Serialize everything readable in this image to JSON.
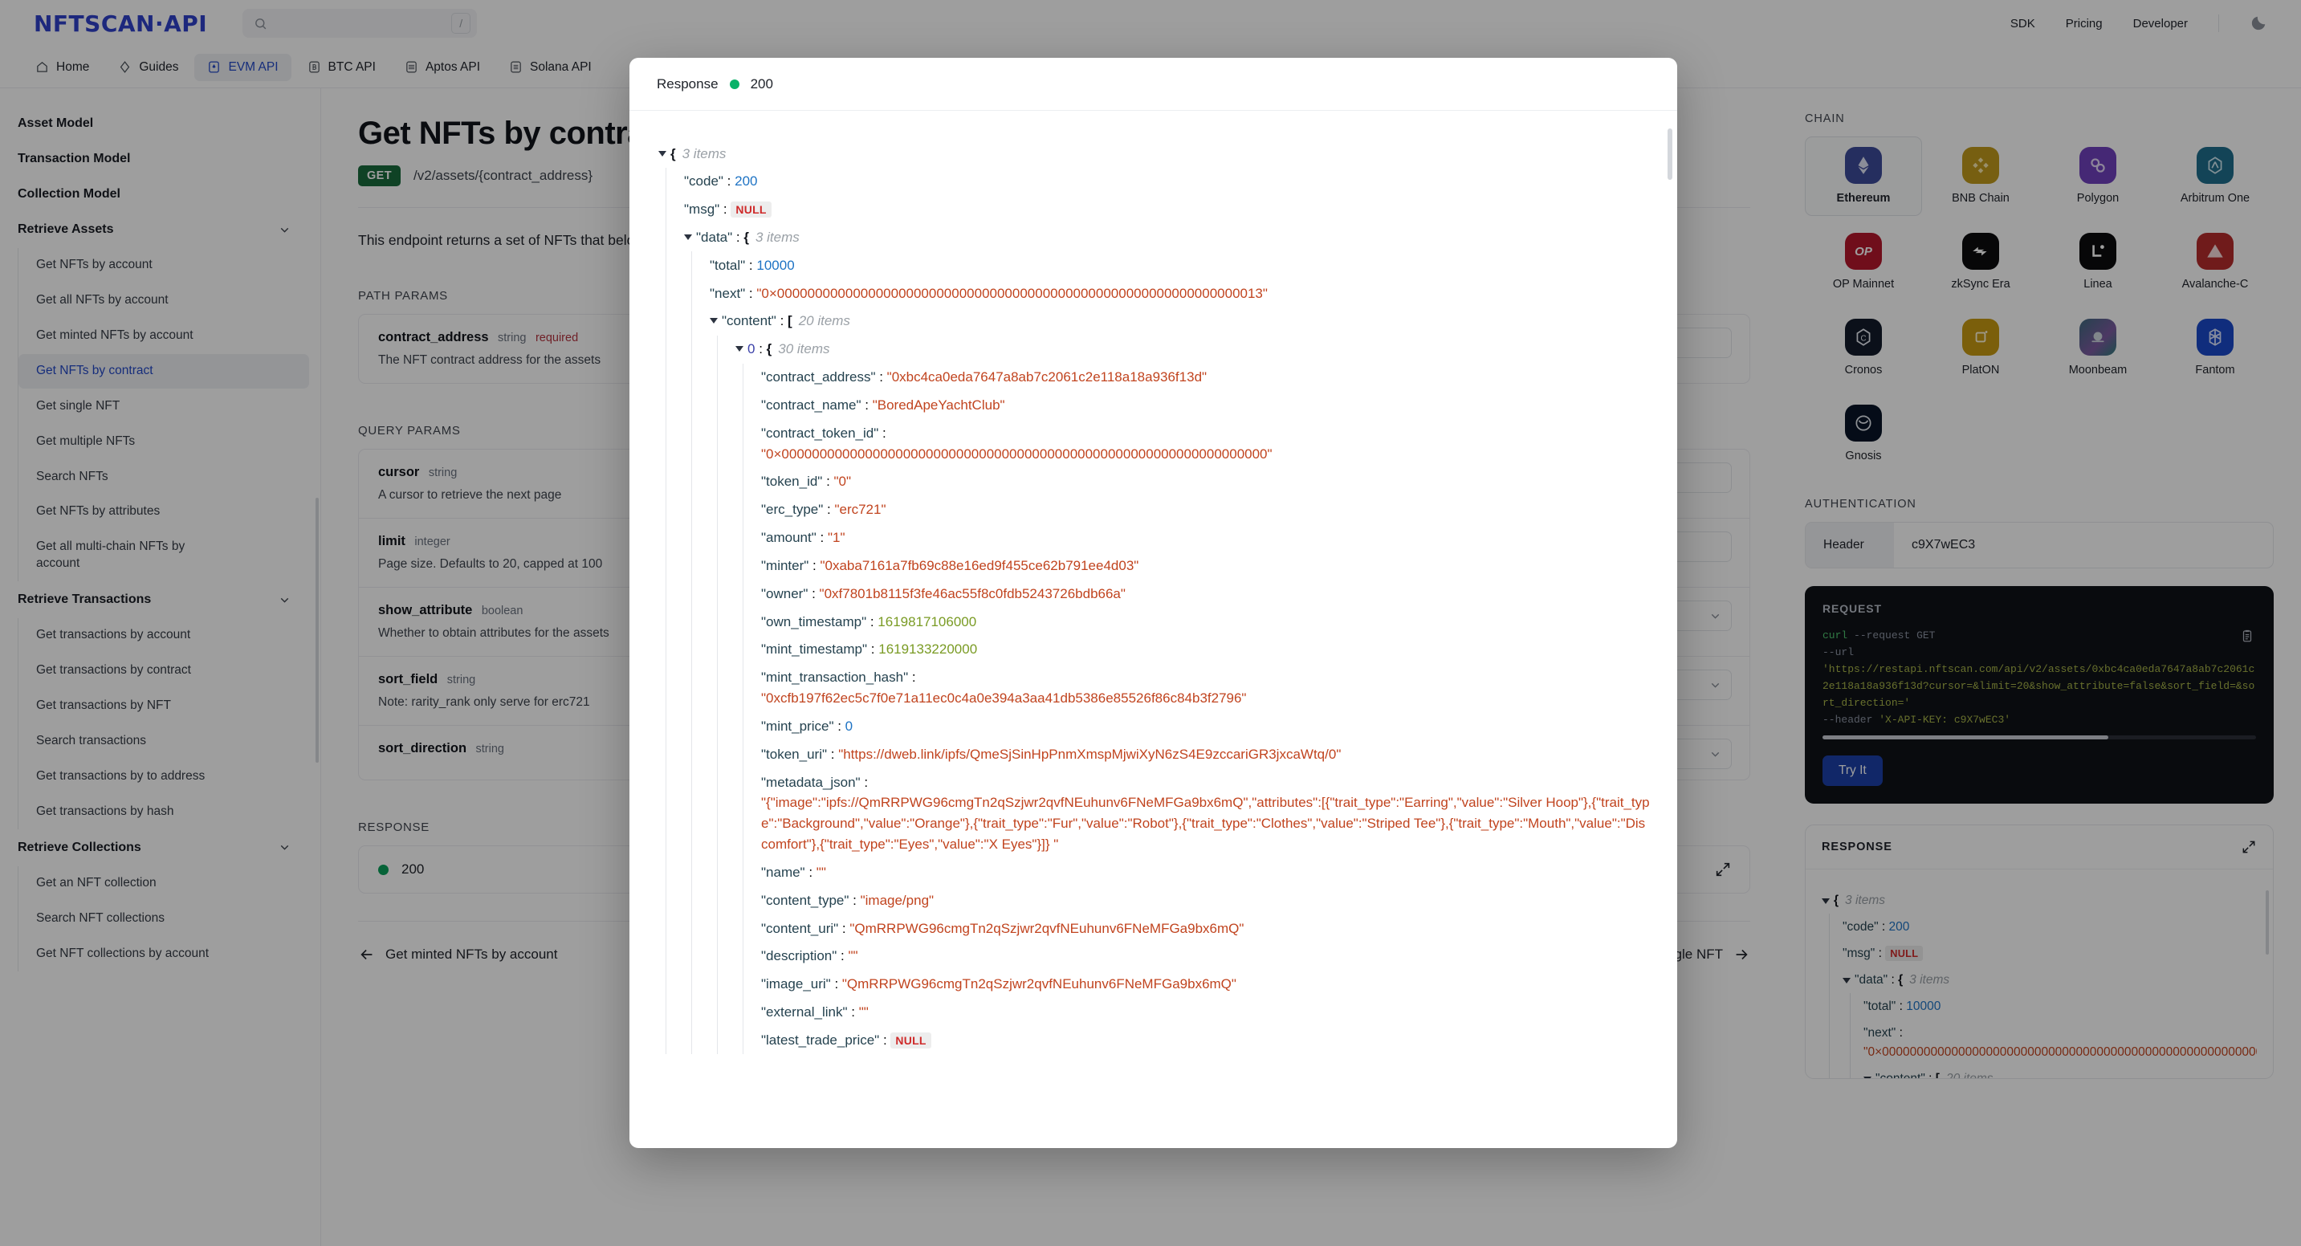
{
  "header": {
    "logo": "NFTSCAN·API",
    "search": {
      "value": "",
      "placeholder": "",
      "shortcut": "/"
    },
    "links": [
      "SDK",
      "Pricing",
      "Developer"
    ],
    "theme_toggle_icon": "moon-icon"
  },
  "nav": {
    "tabs": [
      {
        "label": "Home",
        "icon": "home-icon",
        "active": false
      },
      {
        "label": "Guides",
        "icon": "diamond-icon",
        "active": false
      },
      {
        "label": "EVM API",
        "icon": "ethereum-icon",
        "active": true
      },
      {
        "label": "BTC API",
        "icon": "bitcoin-icon",
        "active": false
      },
      {
        "label": "Aptos API",
        "icon": "aptos-icon",
        "active": false
      },
      {
        "label": "Solana API",
        "icon": "solana-icon",
        "active": false
      }
    ]
  },
  "sidebar": {
    "groups": [
      {
        "label": "Asset Model",
        "collapsible": false,
        "items": []
      },
      {
        "label": "Transaction Model",
        "collapsible": false,
        "items": []
      },
      {
        "label": "Collection Model",
        "collapsible": false,
        "items": []
      },
      {
        "label": "Retrieve Assets",
        "collapsible": true,
        "items": [
          {
            "label": "Get NFTs by account",
            "active": false
          },
          {
            "label": "Get all NFTs by account",
            "active": false
          },
          {
            "label": "Get minted NFTs by account",
            "active": false
          },
          {
            "label": "Get NFTs by contract",
            "active": true
          },
          {
            "label": "Get single NFT",
            "active": false
          },
          {
            "label": "Get multiple NFTs",
            "active": false
          },
          {
            "label": "Search NFTs",
            "active": false
          },
          {
            "label": "Get NFTs by attributes",
            "active": false
          },
          {
            "label": "Get all multi-chain NFTs by account",
            "active": false
          }
        ]
      },
      {
        "label": "Retrieve Transactions",
        "collapsible": true,
        "items": [
          {
            "label": "Get transactions by account",
            "active": false
          },
          {
            "label": "Get transactions by contract",
            "active": false
          },
          {
            "label": "Get transactions by NFT",
            "active": false
          },
          {
            "label": "Search transactions",
            "active": false
          },
          {
            "label": "Get transactions by to address",
            "active": false
          },
          {
            "label": "Get transactions by hash",
            "active": false
          }
        ]
      },
      {
        "label": "Retrieve Collections",
        "collapsible": true,
        "items": [
          {
            "label": "Get an NFT collection",
            "active": false
          },
          {
            "label": "Search NFT collections",
            "active": false
          },
          {
            "label": "Get NFT collections by account",
            "active": false
          }
        ]
      }
    ]
  },
  "doc": {
    "title": "Get NFTs by contract",
    "method": "GET",
    "path": "/v2/assets/{contract_address}",
    "description": "This endpoint returns a set of NFTs that belong to an NFT contract address.",
    "path_params_label": "PATH PARAMS",
    "query_params_label": "QUERY PARAMS",
    "response_label": "RESPONSE",
    "path_params": [
      {
        "name": "contract_address",
        "type": "string",
        "required": "required",
        "desc": "The NFT contract address for the assets"
      }
    ],
    "query_params": [
      {
        "name": "cursor",
        "type": "string",
        "required": "",
        "desc": "A cursor to retrieve the next page",
        "control": "input"
      },
      {
        "name": "limit",
        "type": "integer",
        "required": "",
        "desc": "Page size. Defaults to 20, capped at 100",
        "control": "input"
      },
      {
        "name": "show_attribute",
        "type": "boolean",
        "required": "",
        "desc": "Whether to obtain attributes for the assets",
        "control": "select"
      },
      {
        "name": "sort_field",
        "type": "string",
        "required": "",
        "desc": "Note: rarity_rank only serve for erc721",
        "control": "select"
      },
      {
        "name": "sort_direction",
        "type": "string",
        "required": "",
        "desc": "",
        "control": "select"
      }
    ],
    "response_status": "200",
    "pager": {
      "prev": "Get minted NFTs by account",
      "next": "Get single NFT"
    }
  },
  "rail": {
    "chain_label": "CHAIN",
    "chains": [
      {
        "name": "Ethereum",
        "active": true,
        "bg": "#3c4a99",
        "glyph": "eth"
      },
      {
        "name": "BNB Chain",
        "active": false,
        "bg": "#c09a1b",
        "glyph": "bnb"
      },
      {
        "name": "Polygon",
        "active": false,
        "bg": "#6f41bd",
        "glyph": "polygon"
      },
      {
        "name": "Arbitrum One",
        "active": false,
        "bg": "#1e6e8c",
        "glyph": "arb"
      },
      {
        "name": "OP Mainnet",
        "active": false,
        "bg": "#b4162b",
        "glyph": "op"
      },
      {
        "name": "zkSync Era",
        "active": false,
        "bg": "#0b0b0d",
        "glyph": "zk"
      },
      {
        "name": "Linea",
        "active": false,
        "bg": "#0b0b0d",
        "glyph": "linea"
      },
      {
        "name": "Avalanche-C",
        "active": false,
        "bg": "#b42b2b",
        "glyph": "avax"
      },
      {
        "name": "Cronos",
        "active": false,
        "bg": "#121a2a",
        "glyph": "cronos"
      },
      {
        "name": "PlatON",
        "active": false,
        "bg": "#c79a12",
        "glyph": "platon"
      },
      {
        "name": "Moonbeam",
        "active": false,
        "bg": "#2e7d7a",
        "glyph": "moonbeam"
      },
      {
        "name": "Fantom",
        "active": false,
        "bg": "#1a49c9",
        "glyph": "fantom"
      },
      {
        "name": "Gnosis",
        "active": false,
        "bg": "#081426",
        "glyph": "gnosis"
      }
    ],
    "auth_label": "AUTHENTICATION",
    "auth_key_label": "Header",
    "auth_key_value": "c9X7wEC3",
    "request_label": "REQUEST",
    "request": {
      "cmd": "curl",
      "flag_request": "--request",
      "method": "GET",
      "flag_url": "--url",
      "url": "'https://restapi.nftscan.com/api/v2/assets/0xbc4ca0eda7647a8ab7c2061c2e118a18a936f13d?cursor=&limit=20&show_attribute=false&sort_field=&sort_direction='",
      "flag_header": "--header",
      "header": "'X-API-KEY: c9X7wEC3'"
    },
    "try_it_label": "Try It",
    "response_label": "RESPONSE",
    "expand_icon": "expand-icon",
    "copy_icon": "clipboard-icon"
  },
  "modal": {
    "title": "Response",
    "status_dot_color": "#09b268",
    "status": "200"
  },
  "json_tree": {
    "root_items": "3 items",
    "code_key": "\"code\"",
    "code_value": "200",
    "msg_key": "\"msg\"",
    "msg_value": "NULL",
    "data_key": "\"data\"",
    "data_items": "3 items",
    "total_key": "\"total\"",
    "total_value": "10000",
    "next_key": "\"next\"",
    "next_value": "\"0×0000000000000000000000000000000000000000000000000000000000000013\"",
    "content_key": "\"content\"",
    "content_items": "20 items",
    "index0": "0",
    "index0_items": "30 items",
    "fields": [
      {
        "key": "\"contract_address\"",
        "value": "\"0xbc4ca0eda7647a8ab7c2061c2e118a18a936f13d\"",
        "kind": "str",
        "wrap": false
      },
      {
        "key": "\"contract_name\"",
        "value": "\"BoredApeYachtClub\"",
        "kind": "str",
        "wrap": false
      },
      {
        "key": "\"contract_token_id\"",
        "value": "\"0×0000000000000000000000000000000000000000000000000000000000000000\"",
        "kind": "str",
        "wrap": true
      },
      {
        "key": "\"token_id\"",
        "value": "\"0\"",
        "kind": "str",
        "wrap": false
      },
      {
        "key": "\"erc_type\"",
        "value": "\"erc721\"",
        "kind": "str",
        "wrap": false
      },
      {
        "key": "\"amount\"",
        "value": "\"1\"",
        "kind": "str",
        "wrap": false
      },
      {
        "key": "\"minter\"",
        "value": "\"0xaba7161a7fb69c88e16ed9f455ce62b791ee4d03\"",
        "kind": "str",
        "wrap": false
      },
      {
        "key": "\"owner\"",
        "value": "\"0xf7801b8115f3fe46ac55f8c0fdb5243726bdb66a\"",
        "kind": "str",
        "wrap": false
      },
      {
        "key": "\"own_timestamp\"",
        "value": "1619817106000",
        "kind": "ts",
        "wrap": false
      },
      {
        "key": "\"mint_timestamp\"",
        "value": "1619133220000",
        "kind": "ts",
        "wrap": false
      },
      {
        "key": "\"mint_transaction_hash\"",
        "value": "\"0xcfb197f62ec5c7f0e71a11ec0c4a0e394a3aa41db5386e85526f86c84b3f2796\"",
        "kind": "str",
        "wrap": true
      },
      {
        "key": "\"mint_price\"",
        "value": "0",
        "kind": "num",
        "wrap": false
      },
      {
        "key": "\"token_uri\"",
        "value": "\"https://dweb.link/ipfs/QmeSjSinHpPnmXmspMjwiXyN6zS4E9zccariGR3jxcaWtq/0\"",
        "kind": "str",
        "wrap": false
      },
      {
        "key": "\"metadata_json\"",
        "value": "\"{\"image\":\"ipfs://QmRRPWG96cmgTn2qSzjwr2qvfNEuhunv6FNeMFGa9bx6mQ\",\"attributes\":[{\"trait_type\":\"Earring\",\"value\":\"Silver Hoop\"},{\"trait_type\":\"Background\",\"value\":\"Orange\"},{\"trait_type\":\"Fur\",\"value\":\"Robot\"},{\"trait_type\":\"Clothes\",\"value\":\"Striped Tee\"},{\"trait_type\":\"Mouth\",\"value\":\"Discomfort\"},{\"trait_type\":\"Eyes\",\"value\":\"X Eyes\"}]} \"",
        "kind": "str",
        "wrap": true
      },
      {
        "key": "\"name\"",
        "value": "\"\"",
        "kind": "str",
        "wrap": false
      },
      {
        "key": "\"content_type\"",
        "value": "\"image/png\"",
        "kind": "str",
        "wrap": false
      },
      {
        "key": "\"content_uri\"",
        "value": "\"QmRRPWG96cmgTn2qSzjwr2qvfNEuhunv6FNeMFGa9bx6mQ\"",
        "kind": "str",
        "wrap": false
      },
      {
        "key": "\"description\"",
        "value": "\"\"",
        "kind": "str",
        "wrap": false
      },
      {
        "key": "\"image_uri\"",
        "value": "\"QmRRPWG96cmgTn2qSzjwr2qvfNEuhunv6FNeMFGa9bx6mQ\"",
        "kind": "str",
        "wrap": false
      },
      {
        "key": "\"external_link\"",
        "value": "\"\"",
        "kind": "str",
        "wrap": false
      },
      {
        "key": "\"latest_trade_price\"",
        "value": "NULL",
        "kind": "null",
        "wrap": false
      }
    ]
  }
}
